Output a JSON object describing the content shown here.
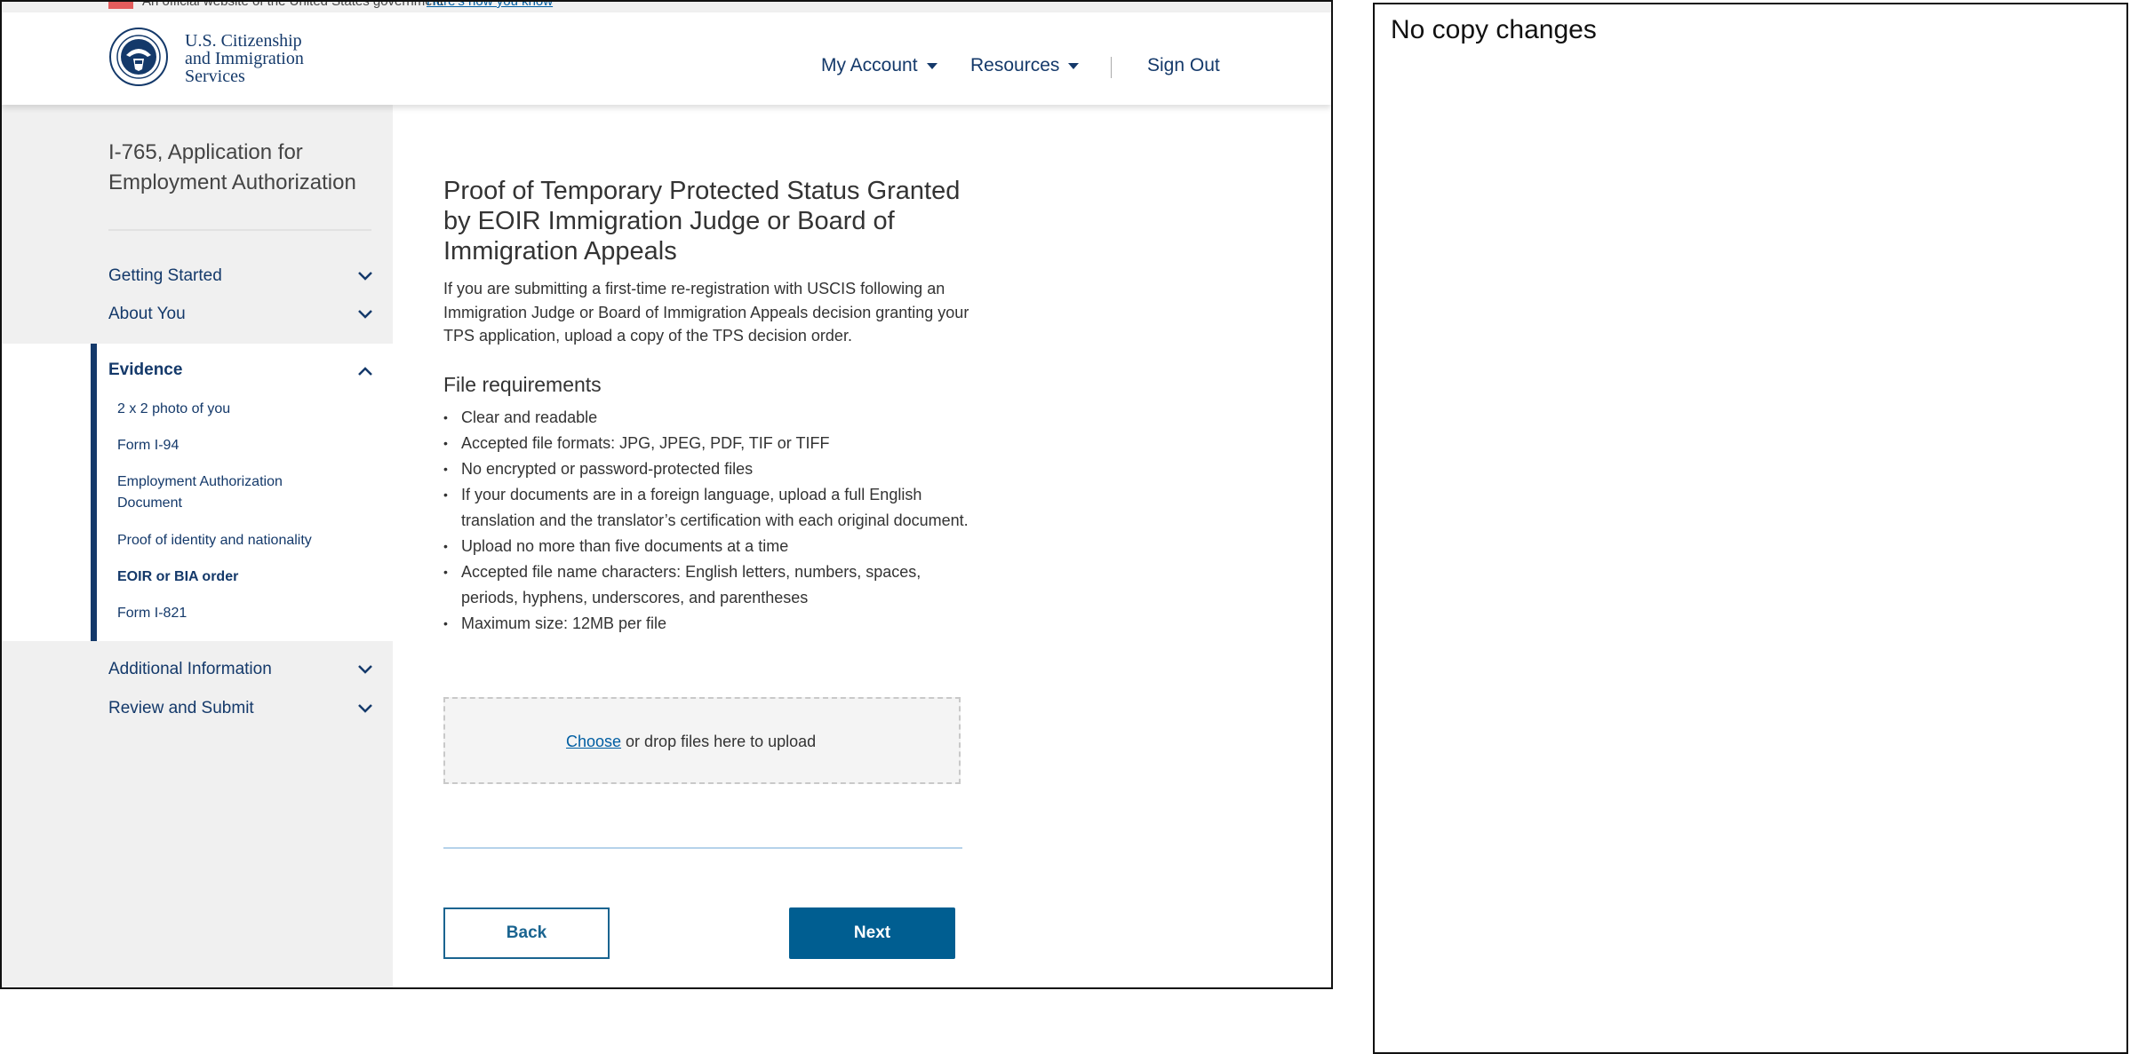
{
  "gov_banner": {
    "text": "An official website of the United States government",
    "link": "Here's how you know"
  },
  "header": {
    "logo_lines": [
      "U.S. Citizenship",
      "and Immigration",
      "Services"
    ],
    "nav": {
      "my_account": "My Account",
      "resources": "Resources",
      "sign_out": "Sign Out"
    }
  },
  "sidebar": {
    "form_title": "I-765, Application for Employment Authorization",
    "sections": {
      "getting_started": "Getting Started",
      "about_you": "About You",
      "evidence": "Evidence",
      "additional_information": "Additional Information",
      "review_and_submit": "Review and Submit"
    },
    "evidence_items": [
      "2 x 2 photo of you",
      "Form I-94",
      "Employment Authorization Document",
      "Proof of identity and nationality",
      "EOIR or BIA order",
      "Form I-821"
    ]
  },
  "main": {
    "title": "Proof of Temporary Protected Status Granted by EOIR Immigration Judge or Board of Immigration Appeals",
    "intro": "If you are submitting a first-time re-registration with USCIS following an Immigration Judge or Board of Immigration Appeals decision granting your TPS application, upload a copy of the TPS decision order.",
    "requirements_title": "File requirements",
    "requirements": [
      "Clear and readable",
      "Accepted file formats: JPG, JPEG, PDF, TIF or TIFF",
      "No encrypted or password-protected files",
      "If your documents are in a foreign language,  upload a full English translation and the translator’s certification with each original document.",
      "Upload no more than five documents at a time",
      "Accepted file name characters: English letters, numbers, spaces, periods, hyphens, underscores, and parentheses",
      "Maximum size: 12MB per file"
    ],
    "upload": {
      "choose": "Choose",
      "rest": " or drop files here to upload"
    },
    "buttons": {
      "back": "Back",
      "next": "Next"
    }
  },
  "annotation": {
    "note": "No copy changes"
  },
  "colors": {
    "brand_navy": "#14396a",
    "button_blue": "#005e91",
    "link_blue": "#005ea2",
    "sidebar_bg": "#f0f0f0"
  }
}
